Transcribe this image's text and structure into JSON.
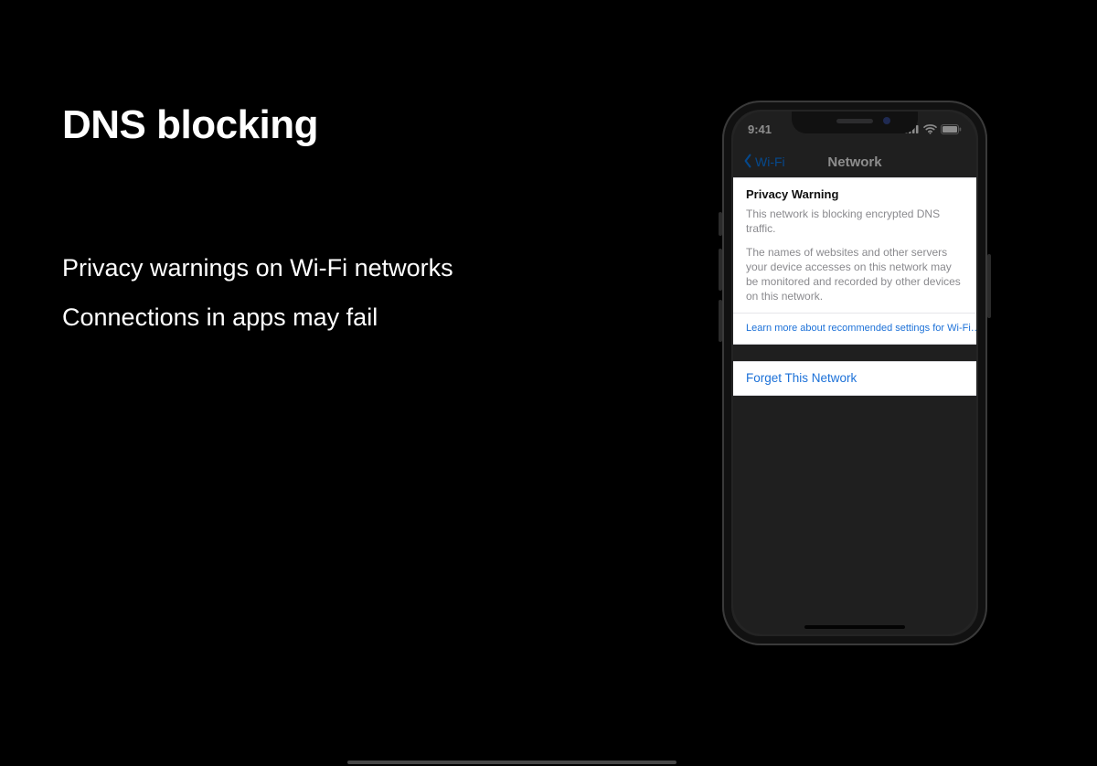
{
  "slide": {
    "title": "DNS blocking",
    "bullets": [
      "Privacy warnings on Wi-Fi networks",
      "Connections in apps may fail"
    ]
  },
  "phone": {
    "status": {
      "time": "9:41"
    },
    "nav": {
      "back_label": "Wi-Fi",
      "title": "Network"
    },
    "warning": {
      "heading": "Privacy Warning",
      "subheading": "This network is blocking encrypted DNS traffic.",
      "body": "The names of websites and other servers your device accesses on this network may be monitored and recorded by other devices on this network."
    },
    "learn_more": "Learn more about recommended settings for Wi-Fi…",
    "forget": "Forget This Network",
    "colors": {
      "ios_blue": "#0a84ff",
      "link_blue": "#1c71d8",
      "muted": "#8a8a8e"
    }
  }
}
